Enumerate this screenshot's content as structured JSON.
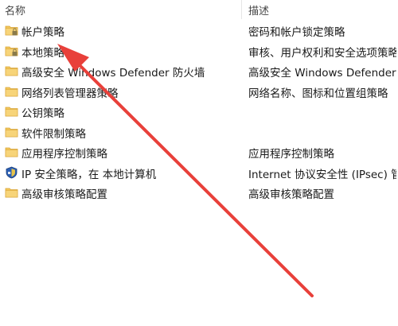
{
  "columns": {
    "name": "名称",
    "description": "描述"
  },
  "rows": [
    {
      "icon": "folder-lock-icon",
      "name": "帐户策略",
      "description": "密码和帐户锁定策略"
    },
    {
      "icon": "folder-lock-icon",
      "name": "本地策略",
      "description": "审核、用户权利和安全选项策略"
    },
    {
      "icon": "folder-icon",
      "name": "高级安全 Windows Defender 防火墙",
      "description": "高级安全 Windows Defender"
    },
    {
      "icon": "folder-icon",
      "name": "网络列表管理器策略",
      "description": "网络名称、图标和位置组策略"
    },
    {
      "icon": "folder-icon",
      "name": "公钥策略",
      "description": ""
    },
    {
      "icon": "folder-icon",
      "name": "软件限制策略",
      "description": ""
    },
    {
      "icon": "folder-icon",
      "name": "应用程序控制策略",
      "description": "应用程序控制策略"
    },
    {
      "icon": "ip-security-shield-icon",
      "name": "IP 安全策略，在 本地计算机",
      "description": "Internet 协议安全性 (IPsec) 管"
    },
    {
      "icon": "folder-icon",
      "name": "高级审核策略配置",
      "description": "高级审核策略配置"
    }
  ],
  "colors": {
    "folder": "#f3c85b",
    "folder_dark": "#d9a53a",
    "lock": "#8a7a4a",
    "annotation_arrow": "#e8403a"
  }
}
